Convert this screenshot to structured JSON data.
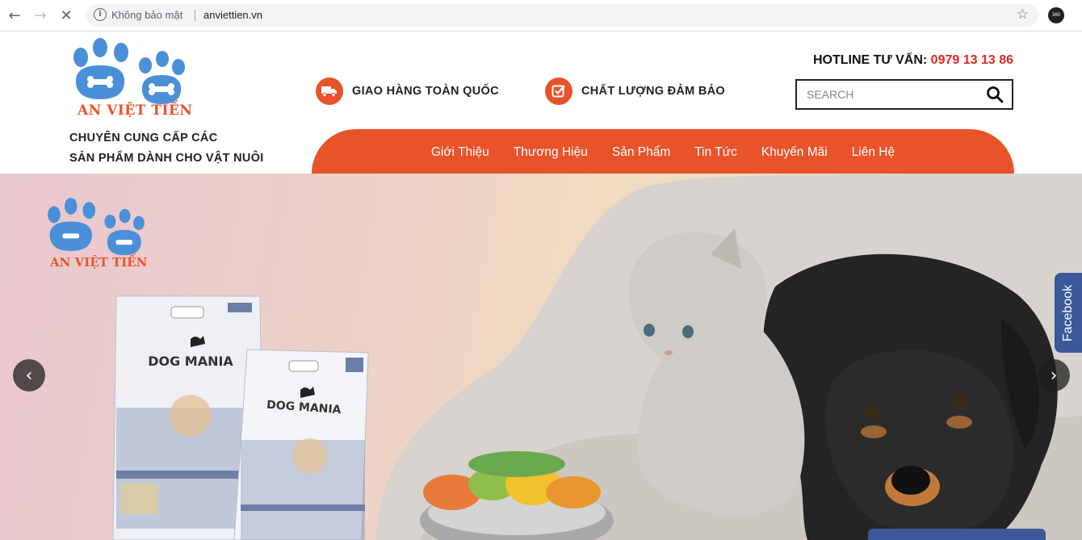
{
  "browser": {
    "security_label": "Không bảo mật",
    "url": "anviettien.vn",
    "info_icon": "info-icon",
    "back_icon": "back-arrow-icon",
    "forward_icon": "forward-arrow-icon",
    "reload_icon": "stop-icon",
    "star_icon": "bookmark-star-icon",
    "profile_label": "360"
  },
  "header": {
    "brand": "AN VIỆT TIẾN",
    "tagline_line1": "CHUYÊN CUNG CẤP CÁC",
    "tagline_line2": "SẢN PHẨM DÀNH CHO VẬT NUÔI",
    "features": [
      {
        "label": "GIAO HÀNG TOÀN QUỐC",
        "icon": "truck-icon"
      },
      {
        "label": "CHẤT LƯỢNG ĐẢM BẢO",
        "icon": "checkbox-icon"
      }
    ],
    "hotline_label": "HOTLINE TƯ VẤN:",
    "hotline_number": "0979 13 13 86",
    "search_placeholder": "SEARCH",
    "accent_color": "#e8532a"
  },
  "menu": {
    "items": [
      {
        "label": "Giới Thiệu"
      },
      {
        "label": "Thương Hiệu"
      },
      {
        "label": "Sản Phẩm"
      },
      {
        "label": "Tin Tức"
      },
      {
        "label": "Khuyến Mãi"
      },
      {
        "label": "Liên Hệ"
      }
    ]
  },
  "hero": {
    "brand": "AN VIỆT TIẾN",
    "product_name": "DOG MANIA",
    "prev_icon": "chevron-left-icon",
    "next_icon": "chevron-right-icon"
  },
  "social": {
    "facebook_label": "Facebook"
  }
}
